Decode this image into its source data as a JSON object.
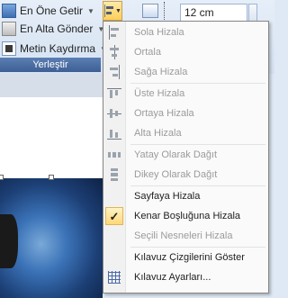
{
  "ribbon": {
    "bring_forward": "En Öne Getir",
    "send_backward": "En Alta Gönder",
    "wrap_text": "Metin Kaydırma",
    "group_label": "Yerleştir",
    "size_value": "12 cm"
  },
  "menu": {
    "items": [
      {
        "label": "Sola Hizala",
        "icon": "align-left-icon",
        "enabled": false
      },
      {
        "label": "Ortala",
        "icon": "align-center-icon",
        "enabled": false
      },
      {
        "label": "Sağa Hizala",
        "icon": "align-right-icon",
        "enabled": false
      },
      {
        "label": "Üste Hizala",
        "icon": "align-top-icon",
        "enabled": false
      },
      {
        "label": "Ortaya Hizala",
        "icon": "align-middle-icon",
        "enabled": false
      },
      {
        "label": "Alta Hizala",
        "icon": "align-bottom-icon",
        "enabled": false
      },
      {
        "label": "Yatay Olarak Dağıt",
        "icon": "distribute-horizontal-icon",
        "enabled": false
      },
      {
        "label": "Dikey Olarak Dağıt",
        "icon": "distribute-vertical-icon",
        "enabled": false
      },
      {
        "label": "Sayfaya Hizala",
        "icon": "",
        "enabled": true
      },
      {
        "label": "Kenar Boşluğuna Hizala",
        "icon": "checkmark-icon",
        "enabled": true,
        "checked": true
      },
      {
        "label": "Seçili Nesneleri Hizala",
        "icon": "",
        "enabled": false
      },
      {
        "label": "Kılavuz Çizgilerini Göster",
        "icon": "",
        "enabled": true
      },
      {
        "label": "Kılavuz Ayarları...",
        "icon": "grid-settings-icon",
        "enabled": true
      }
    ]
  },
  "colors": {
    "accent_highlight": "#ffd878",
    "group_label_bg": "#3d5f93",
    "disabled_text": "#9b9b9b"
  }
}
